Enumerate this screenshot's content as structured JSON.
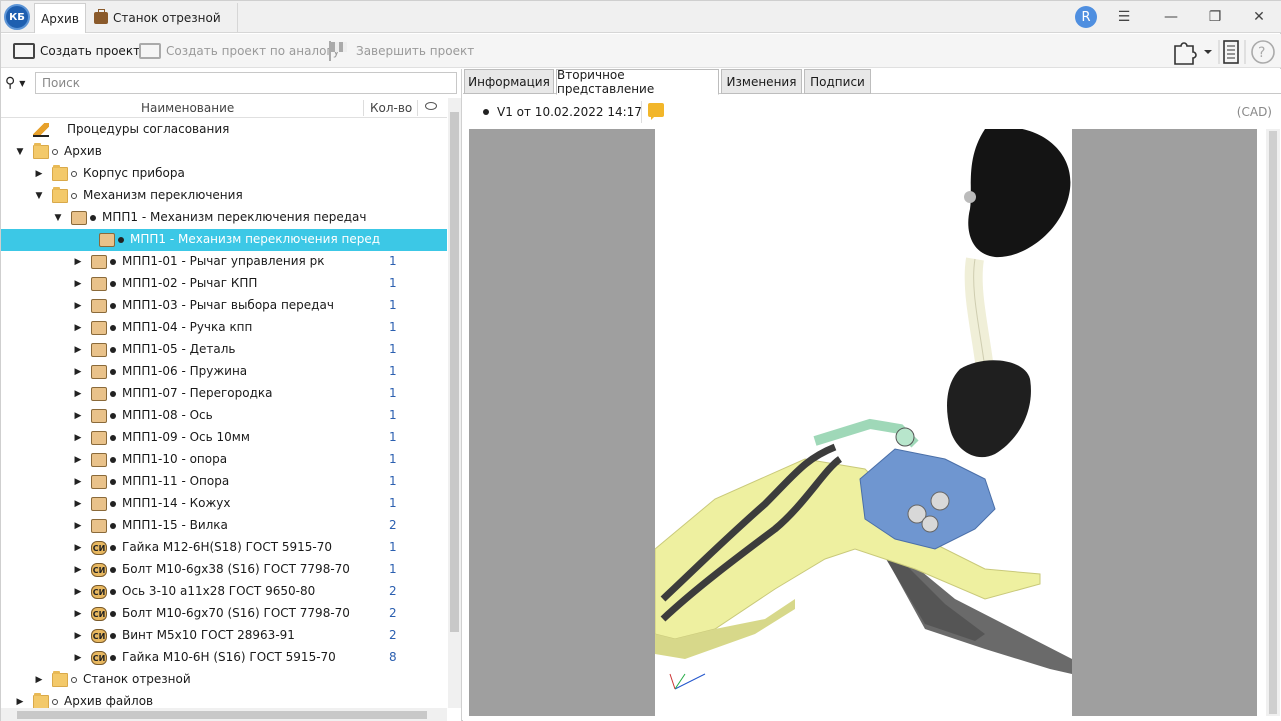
{
  "titlebar": {
    "logo": "КБ",
    "tabs": [
      "Архив",
      "Станок отрезной"
    ],
    "user_initial": "R",
    "window_icons": [
      "menu-icon",
      "minimize-icon",
      "restore-icon",
      "close-icon"
    ]
  },
  "toolbar": {
    "create_project": "Создать проект",
    "create_by_analog": "Создать проект по аналогу",
    "finish_project": "Завершить проект"
  },
  "search": {
    "placeholder": "Поиск"
  },
  "tree_columns": {
    "name": "Наименование",
    "qty": "Кол-во"
  },
  "tree": [
    {
      "label": "Процедуры согласования",
      "level": 1,
      "icon": "pencil",
      "arrow": "",
      "dot": "",
      "qty": ""
    },
    {
      "label": "Архив",
      "level": 0,
      "icon": "folder",
      "arrow": "down",
      "dot": "hollow",
      "qty": ""
    },
    {
      "label": "Корпус прибора",
      "level": 1,
      "icon": "folder",
      "arrow": "right",
      "dot": "hollow",
      "qty": ""
    },
    {
      "label": "Механизм переключения",
      "level": 1,
      "icon": "folder",
      "arrow": "down",
      "dot": "hollow",
      "qty": ""
    },
    {
      "label": "МПП1 - Механизм переключения передач",
      "level": 2,
      "icon": "assembly",
      "arrow": "down",
      "dot": "filled",
      "qty": ""
    },
    {
      "label": "МПП1 - Механизм переключения перед",
      "level": 3,
      "icon": "doc",
      "arrow": "",
      "dot": "filled",
      "qty": "",
      "selected": true
    },
    {
      "label": "МПП1-01 - Рычаг управления рк",
      "level": 3,
      "icon": "part",
      "arrow": "right",
      "dot": "filled",
      "qty": "1"
    },
    {
      "label": "МПП1-02 - Рычаг КПП",
      "level": 3,
      "icon": "part",
      "arrow": "right",
      "dot": "filled",
      "qty": "1"
    },
    {
      "label": "МПП1-03 - Рычаг выбора передач",
      "level": 3,
      "icon": "part",
      "arrow": "right",
      "dot": "filled",
      "qty": "1"
    },
    {
      "label": "МПП1-04 - Ручка кпп",
      "level": 3,
      "icon": "part",
      "arrow": "right",
      "dot": "filled",
      "qty": "1"
    },
    {
      "label": "МПП1-05 - Деталь",
      "level": 3,
      "icon": "part",
      "arrow": "right",
      "dot": "filled",
      "qty": "1"
    },
    {
      "label": "МПП1-06 - Пружина",
      "level": 3,
      "icon": "part",
      "arrow": "right",
      "dot": "filled",
      "qty": "1"
    },
    {
      "label": "МПП1-07 - Перегородка",
      "level": 3,
      "icon": "part",
      "arrow": "right",
      "dot": "filled",
      "qty": "1"
    },
    {
      "label": "МПП1-08 - Ось",
      "level": 3,
      "icon": "part",
      "arrow": "right",
      "dot": "filled",
      "qty": "1"
    },
    {
      "label": "МПП1-09 - Ось 10мм",
      "level": 3,
      "icon": "part",
      "arrow": "right",
      "dot": "filled",
      "qty": "1"
    },
    {
      "label": "МПП1-10 - опора",
      "level": 3,
      "icon": "part",
      "arrow": "right",
      "dot": "filled",
      "qty": "1"
    },
    {
      "label": "МПП1-11 - Опора",
      "level": 3,
      "icon": "part",
      "arrow": "right",
      "dot": "filled",
      "qty": "1"
    },
    {
      "label": "МПП1-14 - Кожух",
      "level": 3,
      "icon": "part",
      "arrow": "right",
      "dot": "filled",
      "qty": "1"
    },
    {
      "label": "МПП1-15 - Вилка",
      "level": 3,
      "icon": "part",
      "arrow": "right",
      "dot": "filled",
      "qty": "2"
    },
    {
      "label": "Гайка М12-6Н(S18) ГОСТ 5915-70",
      "level": 3,
      "icon": "si",
      "arrow": "right",
      "dot": "filled",
      "qty": "1"
    },
    {
      "label": "Болт М10-6gx38 (S16) ГОСТ 7798-70",
      "level": 3,
      "icon": "si",
      "arrow": "right",
      "dot": "filled",
      "qty": "1"
    },
    {
      "label": "Ось 3-10 а11х28 ГОСТ 9650-80",
      "level": 3,
      "icon": "si",
      "arrow": "right",
      "dot": "filled",
      "qty": "2"
    },
    {
      "label": "Болт М10-6gx70 (S16) ГОСТ 7798-70",
      "level": 3,
      "icon": "si",
      "arrow": "right",
      "dot": "filled",
      "qty": "2"
    },
    {
      "label": "Винт М5х10 ГОСТ 28963-91",
      "level": 3,
      "icon": "si",
      "arrow": "right",
      "dot": "filled",
      "qty": "2"
    },
    {
      "label": "Гайка М10-6Н (S16) ГОСТ 5915-70",
      "level": 3,
      "icon": "si",
      "arrow": "right",
      "dot": "filled",
      "qty": "8"
    },
    {
      "label": "Станок отрезной",
      "level": 1,
      "icon": "folder",
      "arrow": "right",
      "dot": "hollow",
      "qty": ""
    },
    {
      "label": "Архив файлов",
      "level": 0,
      "icon": "folder",
      "arrow": "right",
      "dot": "hollow",
      "qty": ""
    }
  ],
  "right_tabs": [
    "Информация",
    "Вторичное представление",
    "Изменения",
    "Подписи"
  ],
  "active_right_tab": "Вторичное представление",
  "version": {
    "label": "V1 от 10.02.2022 14:17"
  },
  "format_label": "(CAD)",
  "si_text": "СИ",
  "colors": {
    "selection": "#3cc8e6",
    "accent": "#2b5fb0"
  }
}
